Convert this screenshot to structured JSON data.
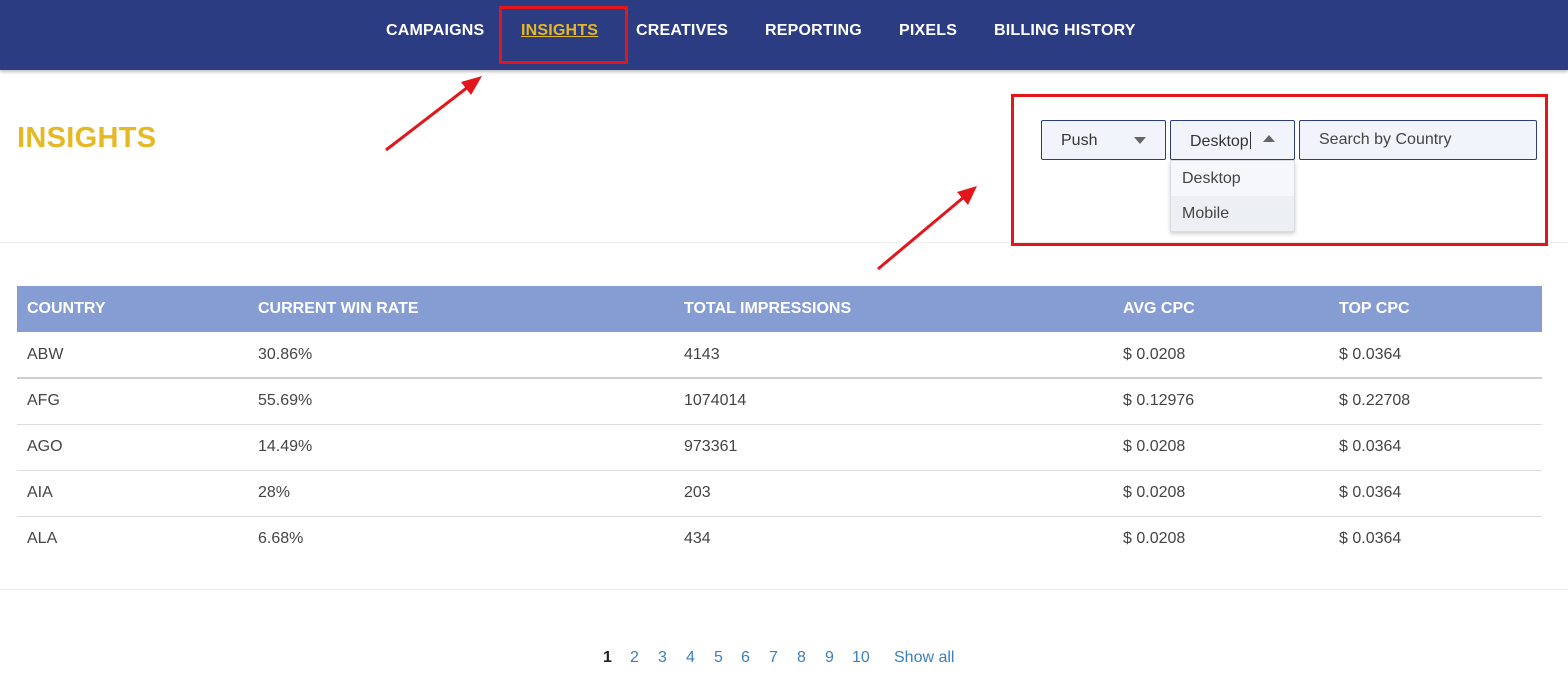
{
  "nav": {
    "items": [
      {
        "label": "CAMPAIGNS"
      },
      {
        "label": "INSIGHTS"
      },
      {
        "label": "CREATIVES"
      },
      {
        "label": "REPORTING"
      },
      {
        "label": "PIXELS"
      },
      {
        "label": "BILLING HISTORY"
      }
    ],
    "active": "INSIGHTS"
  },
  "page": {
    "title": "INSIGHTS"
  },
  "filters": {
    "type_select": {
      "value": "Push",
      "icon": "chevron-down-icon"
    },
    "device_select": {
      "value": "Desktop",
      "expanded": true,
      "icon": "chevron-up-icon",
      "options": [
        {
          "label": "Desktop"
        },
        {
          "label": "Mobile"
        }
      ]
    },
    "search": {
      "placeholder": "Search by Country",
      "value": ""
    }
  },
  "table": {
    "headers": [
      "COUNTRY",
      "CURRENT WIN RATE",
      "TOTAL IMPRESSIONS",
      "AVG CPC",
      "TOP CPC"
    ],
    "rows": [
      [
        "ABW",
        "30.86%",
        "4143",
        "$ 0.0208",
        "$ 0.0364"
      ],
      [
        "AFG",
        "55.69%",
        "1074014",
        "$ 0.12976",
        "$ 0.22708"
      ],
      [
        "AGO",
        "14.49%",
        "973361",
        "$ 0.0208",
        "$ 0.0364"
      ],
      [
        "AIA",
        "28%",
        "203",
        "$ 0.0208",
        "$ 0.0364"
      ],
      [
        "ALA",
        "6.68%",
        "434",
        "$ 0.0208",
        "$ 0.0364"
      ]
    ]
  },
  "pagination": {
    "pages": [
      "1",
      "2",
      "3",
      "4",
      "5",
      "6",
      "7",
      "8",
      "9",
      "10"
    ],
    "current": "1",
    "show_all": "Show all"
  },
  "colors": {
    "nav_bg": "#2b3c82",
    "accent_yellow": "#e6b824",
    "table_header_bg": "#869dd4",
    "annotation_red": "#e3161b",
    "link_blue": "#3c7fbf"
  }
}
